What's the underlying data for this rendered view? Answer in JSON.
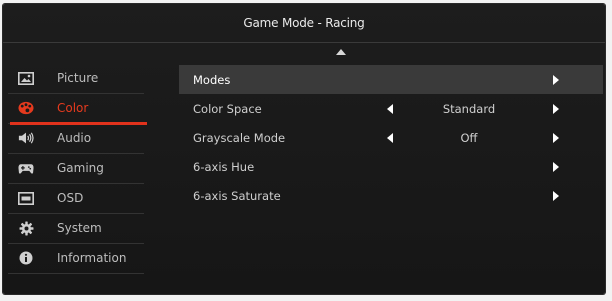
{
  "osd": {
    "title": "Game Mode - Racing"
  },
  "sidebar": {
    "items": [
      {
        "label": "Picture",
        "icon": "picture-icon",
        "active": false
      },
      {
        "label": "Color",
        "icon": "color-palette-icon",
        "active": true
      },
      {
        "label": "Audio",
        "icon": "speaker-icon",
        "active": false
      },
      {
        "label": "Gaming",
        "icon": "gamepad-icon",
        "active": false
      },
      {
        "label": "OSD",
        "icon": "osd-icon",
        "active": false
      },
      {
        "label": "System",
        "icon": "gear-icon",
        "active": false
      },
      {
        "label": "Information",
        "icon": "info-icon",
        "active": false
      }
    ]
  },
  "panel": {
    "rows": [
      {
        "label": "Modes",
        "value": "",
        "left_arrow": false,
        "right_arrow": true,
        "highlighted": true
      },
      {
        "label": "Color Space",
        "value": "Standard",
        "left_arrow": true,
        "right_arrow": true,
        "highlighted": false
      },
      {
        "label": "Grayscale Mode",
        "value": "Off",
        "left_arrow": true,
        "right_arrow": true,
        "highlighted": false
      },
      {
        "label": "6-axis Hue",
        "value": "",
        "left_arrow": false,
        "right_arrow": true,
        "highlighted": false
      },
      {
        "label": "6-axis Saturate",
        "value": "",
        "left_arrow": false,
        "right_arrow": true,
        "highlighted": false
      }
    ]
  },
  "colors": {
    "accent": "#e0321c",
    "background": "#1a1a1a",
    "highlight": "#3a3a3a"
  }
}
